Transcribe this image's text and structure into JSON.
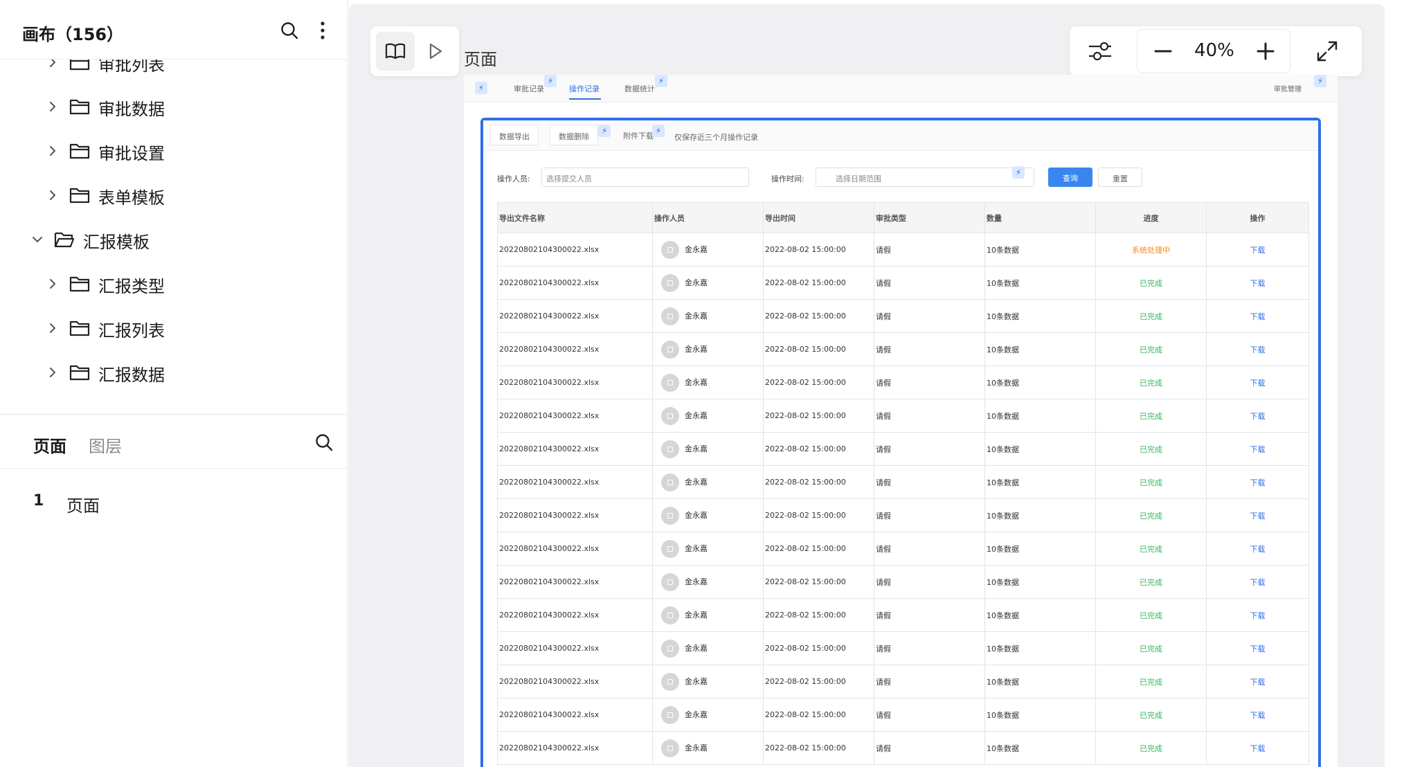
{
  "left_panel": {
    "canvas_title": "画布（156）",
    "tree": [
      {
        "label": "审批列表",
        "expanded": false
      },
      {
        "label": "审批数据",
        "expanded": false
      },
      {
        "label": "审批设置",
        "expanded": false
      },
      {
        "label": "表单模板",
        "expanded": false
      },
      {
        "label": "汇报模板",
        "expanded": true
      },
      {
        "label": "汇报类型",
        "expanded": false
      },
      {
        "label": "汇报列表",
        "expanded": false
      },
      {
        "label": "汇报数据",
        "expanded": false
      }
    ],
    "pages_tabs": {
      "pages": "页面",
      "layers": "图层"
    },
    "page_list": [
      {
        "index": "1",
        "name": "页面"
      }
    ]
  },
  "toolbar": {
    "frame_label": "页面",
    "zoom": "40%"
  },
  "frame": {
    "top_tabs": [
      "审批记录",
      "操作记录",
      "数据统计"
    ],
    "top_right_link": "审批管理",
    "sub_tabs": [
      "数据导出",
      "数据删除",
      "附件下载"
    ],
    "sub_note": "仅保存近三个月操作记录",
    "filters": {
      "operator_label": "操作人员:",
      "operator_placeholder": "选择提交人员",
      "time_label": "操作时间:",
      "time_placeholder": "选择日期范围",
      "query_button": "查询",
      "reset_button": "重置"
    },
    "table": {
      "columns": [
        "导出文件名称",
        "操作人员",
        "导出时间",
        "审批类型",
        "数量",
        "进度",
        "操作"
      ],
      "rows": [
        {
          "file": "20220802104300022.xlsx",
          "operator": "金永嘉",
          "time": "2022-08-02 15:00:00",
          "type": "请假",
          "count": "10条数据",
          "status": "系统处理中",
          "status_kind": "processing",
          "action": "下载"
        },
        {
          "file": "20220802104300022.xlsx",
          "operator": "金永嘉",
          "time": "2022-08-02 15:00:00",
          "type": "请假",
          "count": "10条数据",
          "status": "已完成",
          "status_kind": "done",
          "action": "下载"
        },
        {
          "file": "20220802104300022.xlsx",
          "operator": "金永嘉",
          "time": "2022-08-02 15:00:00",
          "type": "请假",
          "count": "10条数据",
          "status": "已完成",
          "status_kind": "done",
          "action": "下载"
        },
        {
          "file": "20220802104300022.xlsx",
          "operator": "金永嘉",
          "time": "2022-08-02 15:00:00",
          "type": "请假",
          "count": "10条数据",
          "status": "已完成",
          "status_kind": "done",
          "action": "下载"
        },
        {
          "file": "20220802104300022.xlsx",
          "operator": "金永嘉",
          "time": "2022-08-02 15:00:00",
          "type": "请假",
          "count": "10条数据",
          "status": "已完成",
          "status_kind": "done",
          "action": "下载"
        },
        {
          "file": "20220802104300022.xlsx",
          "operator": "金永嘉",
          "time": "2022-08-02 15:00:00",
          "type": "请假",
          "count": "10条数据",
          "status": "已完成",
          "status_kind": "done",
          "action": "下载"
        },
        {
          "file": "20220802104300022.xlsx",
          "operator": "金永嘉",
          "time": "2022-08-02 15:00:00",
          "type": "请假",
          "count": "10条数据",
          "status": "已完成",
          "status_kind": "done",
          "action": "下载"
        },
        {
          "file": "20220802104300022.xlsx",
          "operator": "金永嘉",
          "time": "2022-08-02 15:00:00",
          "type": "请假",
          "count": "10条数据",
          "status": "已完成",
          "status_kind": "done",
          "action": "下载"
        },
        {
          "file": "20220802104300022.xlsx",
          "operator": "金永嘉",
          "time": "2022-08-02 15:00:00",
          "type": "请假",
          "count": "10条数据",
          "status": "已完成",
          "status_kind": "done",
          "action": "下载"
        },
        {
          "file": "20220802104300022.xlsx",
          "operator": "金永嘉",
          "time": "2022-08-02 15:00:00",
          "type": "请假",
          "count": "10条数据",
          "status": "已完成",
          "status_kind": "done",
          "action": "下载"
        },
        {
          "file": "20220802104300022.xlsx",
          "operator": "金永嘉",
          "time": "2022-08-02 15:00:00",
          "type": "请假",
          "count": "10条数据",
          "status": "已完成",
          "status_kind": "done",
          "action": "下载"
        },
        {
          "file": "20220802104300022.xlsx",
          "operator": "金永嘉",
          "time": "2022-08-02 15:00:00",
          "type": "请假",
          "count": "10条数据",
          "status": "已完成",
          "status_kind": "done",
          "action": "下载"
        },
        {
          "file": "20220802104300022.xlsx",
          "operator": "金永嘉",
          "time": "2022-08-02 15:00:00",
          "type": "请假",
          "count": "10条数据",
          "status": "已完成",
          "status_kind": "done",
          "action": "下载"
        },
        {
          "file": "20220802104300022.xlsx",
          "operator": "金永嘉",
          "time": "2022-08-02 15:00:00",
          "type": "请假",
          "count": "10条数据",
          "status": "已完成",
          "status_kind": "done",
          "action": "下载"
        },
        {
          "file": "20220802104300022.xlsx",
          "operator": "金永嘉",
          "time": "2022-08-02 15:00:00",
          "type": "请假",
          "count": "10条数据",
          "status": "已完成",
          "status_kind": "done",
          "action": "下载"
        },
        {
          "file": "20220802104300022.xlsx",
          "operator": "金永嘉",
          "time": "2022-08-02 15:00:00",
          "type": "请假",
          "count": "10条数据",
          "status": "已完成",
          "status_kind": "done",
          "action": "下载"
        }
      ]
    }
  },
  "colors": {
    "accent": "#2f6fe4",
    "selection_border": "#2f6fe4",
    "status_processing": "#f08a24",
    "status_done": "#2eb855",
    "canvas_bg": "#f0f0f2"
  },
  "icons": {
    "canvas_search": "search-icon",
    "canvas_more": "more-vertical-icon",
    "folder": "folder-icon",
    "chevron_collapsed": "chevron-right-icon",
    "chevron_expanded": "chevron-down-icon",
    "pages_search": "search-icon",
    "book": "book-icon",
    "play": "play-icon",
    "filter": "sliders-icon",
    "zoom_out": "minus-icon",
    "zoom_in": "plus-icon",
    "fullscreen": "expand-icon",
    "bolt": "lightning-icon"
  }
}
